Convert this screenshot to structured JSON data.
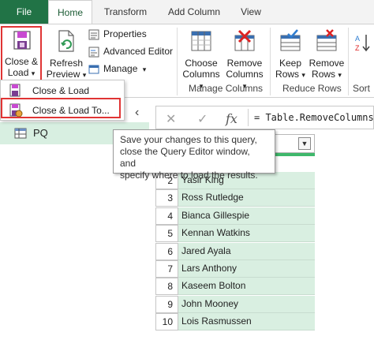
{
  "tabs": {
    "file": "File",
    "home": "Home",
    "transform": "Transform",
    "add_column": "Add Column",
    "view": "View"
  },
  "ribbon": {
    "close_load": {
      "line1": "Close &",
      "line2": "Load",
      "arrow": "▾"
    },
    "refresh_preview": {
      "line1": "Refresh",
      "line2": "Preview",
      "arrow": "▾"
    },
    "properties": "Properties",
    "advanced_editor": "Advanced Editor",
    "manage": "Manage",
    "manage_arrow": "▾",
    "choose_columns": {
      "line1": "Choose",
      "line2": "Columns",
      "arrow": "▾"
    },
    "remove_columns": {
      "line1": "Remove",
      "line2": "Columns",
      "arrow": "▾"
    },
    "keep_rows": {
      "line1": "Keep",
      "line2": "Rows",
      "arrow": "▾"
    },
    "remove_rows": {
      "line1": "Remove",
      "line2": "Rows",
      "arrow": "▾"
    },
    "group_manage_columns": "Manage Columns",
    "group_reduce_rows": "Reduce Rows",
    "group_sort": "Sort"
  },
  "dropdown": {
    "close_load": "Close & Load",
    "close_load_to": "Close & Load To..."
  },
  "tooltip": {
    "line1": "Save your changes to this query,",
    "line2": "close the Query Editor window, and",
    "line3": "specify where to load the results."
  },
  "queries": {
    "collapse_arrow": "‹",
    "item": "PQ"
  },
  "formula": {
    "cancel": "✕",
    "commit": "✓",
    "fx": "fx",
    "text": "= Table.RemoveColumns("
  },
  "table": {
    "header_dropdown": "▼",
    "rows": [
      {
        "n": "2",
        "name": "Yasir King"
      },
      {
        "n": "3",
        "name": "Ross Rutledge"
      },
      {
        "n": "4",
        "name": "Bianca Gillespie"
      },
      {
        "n": "5",
        "name": "Kennan Watkins"
      },
      {
        "n": "6",
        "name": "Jared Ayala"
      },
      {
        "n": "7",
        "name": "Lars Anthony"
      },
      {
        "n": "8",
        "name": "Kaseem Bolton"
      },
      {
        "n": "9",
        "name": "John Mooney"
      },
      {
        "n": "10",
        "name": "Lois Rasmussen"
      }
    ]
  },
  "colors": {
    "file_tab": "#217346",
    "highlight_red": "#e03434",
    "selected_green": "#d9efe1",
    "valid_bar": "#3fb86b"
  }
}
